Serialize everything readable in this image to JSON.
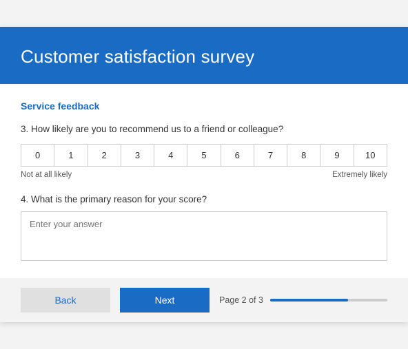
{
  "header": {
    "title": "Customer satisfaction survey"
  },
  "section": {
    "title": "Service feedback"
  },
  "question3": {
    "label": "3. How likely are you to recommend us to a friend or colleague?",
    "scale": [
      "0",
      "1",
      "2",
      "3",
      "4",
      "5",
      "6",
      "7",
      "8",
      "9",
      "10"
    ],
    "label_low": "Not at all likely",
    "label_high": "Extremely likely"
  },
  "question4": {
    "label": "4. What is the primary reason for your score?",
    "placeholder": "Enter your answer"
  },
  "footer": {
    "back_label": "Back",
    "next_label": "Next",
    "page_label": "Page 2 of 3",
    "progress_pct": 66.6
  }
}
